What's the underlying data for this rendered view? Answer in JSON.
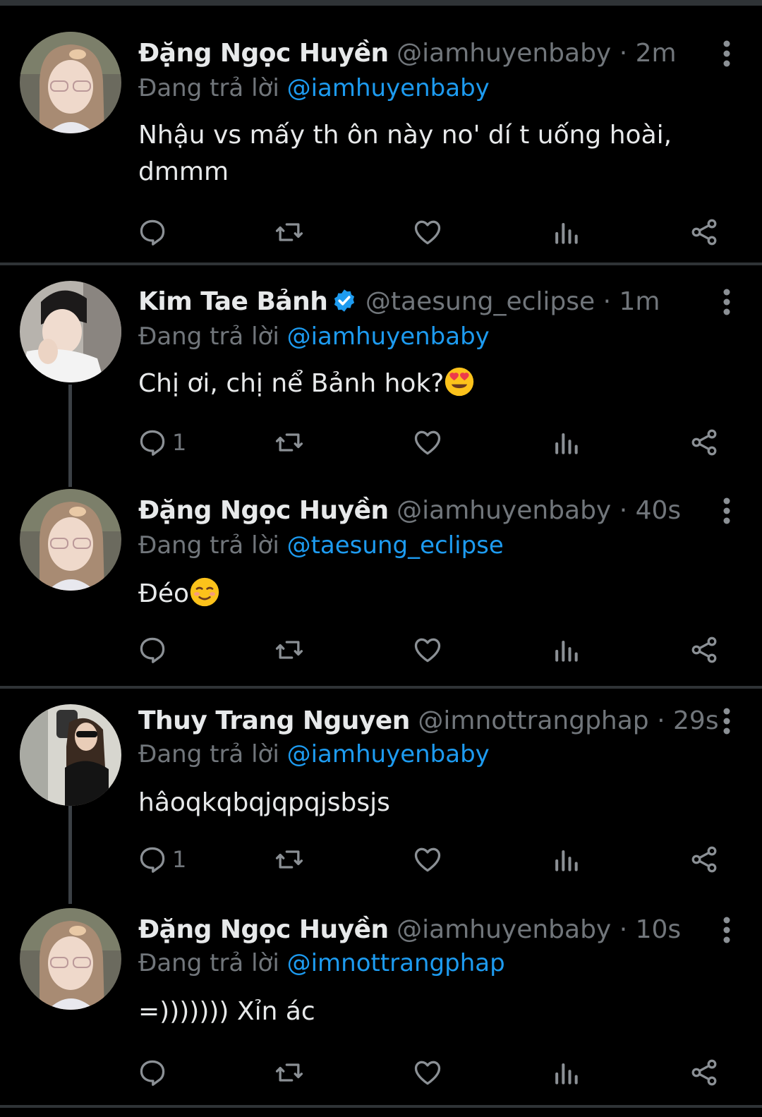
{
  "reply_prefix": "Đang trả lời",
  "tweets": [
    {
      "name": "Đặng Ngọc Huyền",
      "handle": "@iamhuyenbaby",
      "time": "2m",
      "reply_to": "@iamhuyenbaby",
      "text": "Nhậu vs mấy th ôn này no' dí t uống hoài,",
      "text2": "dmmm",
      "reply_count": ""
    },
    {
      "name": "Kim Tae Bảnh",
      "handle": "@taesung_eclipse",
      "time": "1m",
      "reply_to": "@iamhuyenbaby",
      "text": "Chị ơi, chị nể Bảnh hok?",
      "emoji": "heart-eyes-emoji",
      "verified": true,
      "reply_count": "1"
    },
    {
      "name": "Đặng Ngọc Huyền",
      "handle": "@iamhuyenbaby",
      "time": "40s",
      "reply_to": "@taesung_eclipse",
      "text": "Đéo",
      "emoji": "smiling-blush-emoji",
      "reply_count": ""
    },
    {
      "name": "Thuy Trang Nguyen",
      "handle": "@imnottrangphap",
      "time": "29s",
      "reply_to": "@iamhuyenbaby",
      "text": "hâoqkqbqjqpqjsbsjs",
      "reply_count": "1"
    },
    {
      "name": "Đặng Ngọc Huyền",
      "handle": "@iamhuyenbaby",
      "time": "10s",
      "reply_to": "@imnottrangphap",
      "text": "=))))))) Xỉn ác",
      "reply_count": ""
    }
  ],
  "colors": {
    "background": "#000000",
    "text": "#e7e9ea",
    "secondary": "#71767b",
    "accent": "#1d9bf0",
    "divider": "#2f3336"
  }
}
